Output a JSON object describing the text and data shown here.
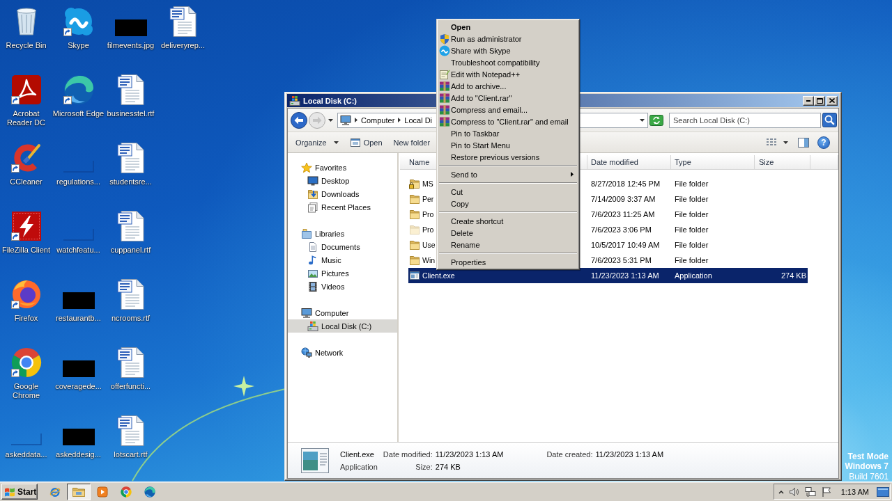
{
  "desktop": {
    "icons": [
      {
        "label": "Recycle Bin",
        "kind": "recycle_bin",
        "shortcut": false
      },
      {
        "label": "Acrobat Reader DC",
        "kind": "acrobat",
        "shortcut": true
      },
      {
        "label": "CCleaner",
        "kind": "ccleaner",
        "shortcut": true
      },
      {
        "label": "FileZilla Client",
        "kind": "filezilla",
        "shortcut": true
      },
      {
        "label": "Firefox",
        "kind": "firefox",
        "shortcut": true
      },
      {
        "label": "Google Chrome",
        "kind": "chrome",
        "shortcut": true
      },
      {
        "label": "askeddata...",
        "kind": "blank_thumbnail",
        "shortcut": false
      },
      {
        "label": "Skype",
        "kind": "skype",
        "shortcut": true
      },
      {
        "label": "Microsoft Edge",
        "kind": "edge",
        "shortcut": true
      },
      {
        "label": "regulations...",
        "kind": "blank_thumbnail",
        "shortcut": false
      },
      {
        "label": "watchfeatu...",
        "kind": "blank_thumbnail",
        "shortcut": false
      },
      {
        "label": "restaurantb...",
        "kind": "dark_thumbnail",
        "shortcut": false
      },
      {
        "label": "coveragede...",
        "kind": "dark_thumbnail",
        "shortcut": false
      },
      {
        "label": "askeddesig...",
        "kind": "dark_thumbnail",
        "shortcut": false
      },
      {
        "label": "filmevents.jpg",
        "kind": "dark_thumbnail",
        "shortcut": false
      },
      {
        "label": "businesstel.rtf",
        "kind": "document",
        "shortcut": false
      },
      {
        "label": "studentsre...",
        "kind": "document",
        "shortcut": false
      },
      {
        "label": "cuppanel.rtf",
        "kind": "document",
        "shortcut": false
      },
      {
        "label": "ncrooms.rtf",
        "kind": "document",
        "shortcut": false
      },
      {
        "label": "offerfuncti...",
        "kind": "document",
        "shortcut": false
      },
      {
        "label": "lotscart.rtf",
        "kind": "document",
        "shortcut": false
      },
      {
        "label": "deliveryrep...",
        "kind": "document",
        "shortcut": false
      }
    ],
    "system_notice": {
      "mode": "Test Mode",
      "edition": "Windows 7",
      "build": "Build 7601"
    }
  },
  "explorer": {
    "title": "Local Disk (C:)",
    "address_bar": {
      "crumbs": [
        "Computer",
        "Local Di"
      ]
    },
    "search": {
      "placeholder": "Search Local Disk (C:)"
    },
    "toolbar": [
      {
        "label": "Organize",
        "kind": "dropdown"
      },
      {
        "label": "Open",
        "kind": "icon"
      },
      {
        "label": "New folder",
        "kind": "plain"
      }
    ],
    "help_button": {
      "glyph": "?"
    },
    "navigation": [
      {
        "label": "Favorites",
        "kind": "favorites",
        "selected": false,
        "children": [
          {
            "label": "Desktop",
            "kind": "desktop",
            "selected": false
          },
          {
            "label": "Downloads",
            "kind": "downloads",
            "selected": false
          },
          {
            "label": "Recent Places",
            "kind": "recent",
            "selected": false
          }
        ]
      },
      {
        "label": "Libraries",
        "kind": "libraries",
        "selected": false,
        "children": [
          {
            "label": "Documents",
            "kind": "documents",
            "selected": false
          },
          {
            "label": "Music",
            "kind": "music",
            "selected": false
          },
          {
            "label": "Pictures",
            "kind": "pictures",
            "selected": false
          },
          {
            "label": "Videos",
            "kind": "videos",
            "selected": false
          }
        ]
      },
      {
        "label": "Computer",
        "kind": "computer",
        "selected": false,
        "children": [
          {
            "label": "Local Disk (C:)",
            "kind": "drive",
            "selected": true
          }
        ]
      },
      {
        "label": "Network",
        "kind": "network",
        "selected": false
      }
    ],
    "columns": [
      "Name",
      "Date modified",
      "Type",
      "Size"
    ],
    "rows": [
      {
        "name": "MS",
        "kind": "locked_folder",
        "date_modified": "8/27/2018 12:45 PM",
        "type": "File folder",
        "selected": false
      },
      {
        "name": "Per",
        "kind": "folder",
        "date_modified": "7/14/2009 3:37 AM",
        "type": "File folder",
        "selected": false
      },
      {
        "name": "Pro",
        "kind": "folder",
        "date_modified": "7/6/2023 11:25 AM",
        "type": "File folder",
        "selected": false
      },
      {
        "name": "Pro",
        "kind": "hidden_folder",
        "date_modified": "7/6/2023 3:06 PM",
        "type": "File folder",
        "selected": false
      },
      {
        "name": "Use",
        "kind": "folder",
        "date_modified": "10/5/2017 10:49 AM",
        "type": "File folder",
        "selected": false
      },
      {
        "name": "Win",
        "kind": "folder",
        "date_modified": "7/6/2023 5:31 PM",
        "type": "File folder",
        "selected": false
      },
      {
        "name": "Client.exe",
        "kind": "application",
        "date_modified": "11/23/2023 1:13 AM",
        "type": "Application",
        "size": "274 KB",
        "selected": true
      }
    ],
    "details": {
      "name": "Client.exe",
      "type": "Application",
      "fields": [
        {
          "label": "Date modified:",
          "value": "11/23/2023 1:13 AM"
        },
        {
          "label": "Date created:",
          "value": "11/23/2023 1:13 AM"
        },
        {
          "label": "Size:",
          "value": "274 KB"
        }
      ]
    }
  },
  "context_menu": {
    "groups": [
      {
        "items": [
          {
            "label": "Open",
            "kind": "plain",
            "default": true,
            "submenu": false
          },
          {
            "label": "Run as administrator",
            "kind": "shield",
            "default": false,
            "submenu": false
          },
          {
            "label": "Share with Skype",
            "kind": "skype",
            "default": false,
            "submenu": false
          },
          {
            "label": "Troubleshoot compatibility",
            "kind": "plain",
            "default": false,
            "submenu": false
          },
          {
            "label": "Edit with Notepad++",
            "kind": "notepad",
            "default": false,
            "submenu": false
          },
          {
            "label": "Add to archive...",
            "kind": "archive",
            "default": false,
            "submenu": false
          },
          {
            "label": "Add to \"Client.rar\"",
            "kind": "archive",
            "default": false,
            "submenu": false
          },
          {
            "label": "Compress and email...",
            "kind": "archive",
            "default": false,
            "submenu": false
          },
          {
            "label": "Compress to \"Client.rar\" and email",
            "kind": "archive",
            "default": false,
            "submenu": false
          },
          {
            "label": "Pin to Taskbar",
            "kind": "plain",
            "default": false,
            "submenu": false
          },
          {
            "label": "Pin to Start Menu",
            "kind": "plain",
            "default": false,
            "submenu": false
          },
          {
            "label": "Restore previous versions",
            "kind": "plain",
            "default": false,
            "submenu": false
          }
        ]
      },
      {
        "items": [
          {
            "label": "Send to",
            "kind": "plain",
            "default": false,
            "submenu": true
          }
        ]
      },
      {
        "items": [
          {
            "label": "Cut",
            "kind": "plain",
            "default": false,
            "submenu": false
          },
          {
            "label": "Copy",
            "kind": "plain",
            "default": false,
            "submenu": false
          }
        ]
      },
      {
        "items": [
          {
            "label": "Create shortcut",
            "kind": "plain",
            "default": false,
            "submenu": false
          },
          {
            "label": "Delete",
            "kind": "plain",
            "default": false,
            "submenu": false
          },
          {
            "label": "Rename",
            "kind": "plain",
            "default": false,
            "submenu": false
          }
        ]
      },
      {
        "items": [
          {
            "label": "Properties",
            "kind": "plain",
            "default": false,
            "submenu": false
          }
        ]
      }
    ]
  },
  "taskbar": {
    "start": "Start",
    "apps": [
      {
        "kind": "ie",
        "selected": false
      },
      {
        "kind": "explorer",
        "selected": true
      },
      {
        "kind": "media_player",
        "selected": false
      },
      {
        "kind": "chrome",
        "selected": false
      },
      {
        "kind": "edge",
        "selected": false
      }
    ],
    "clock": "1:13 AM"
  }
}
